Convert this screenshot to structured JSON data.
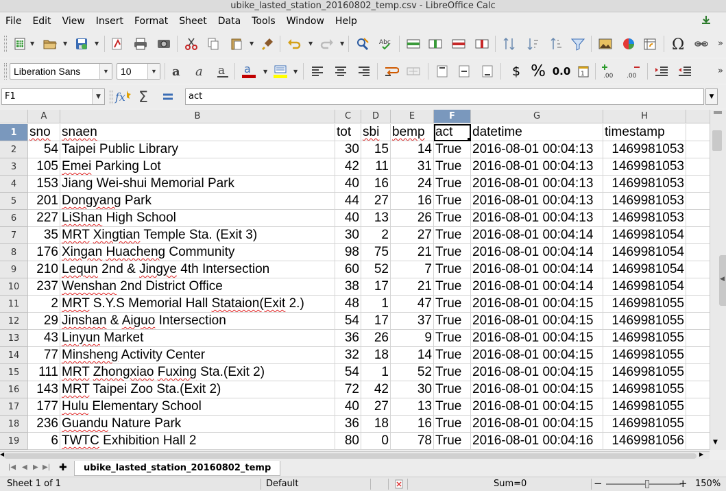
{
  "window": {
    "title": "ubike_lasted_station_20160802_temp.csv - LibreOffice Calc"
  },
  "menu": [
    "File",
    "Edit",
    "View",
    "Insert",
    "Format",
    "Sheet",
    "Data",
    "Tools",
    "Window",
    "Help"
  ],
  "toolbar2": {
    "font_name": "Liberation Sans",
    "font_size": "10",
    "currency": "$",
    "percent": "%",
    "number": "0.0"
  },
  "formula": {
    "name_box": "F1",
    "content": "act"
  },
  "grid": {
    "columns": [
      "A",
      "B",
      "C",
      "D",
      "E",
      "F",
      "G",
      "H"
    ],
    "selected_column": "F",
    "rows": [
      [
        "1",
        "sno",
        "snaen",
        "tot",
        "sbi",
        "bemp",
        "act",
        "datetime",
        "timestamp"
      ],
      [
        "2",
        "54",
        "Taipei Public Library",
        "30",
        "15",
        "14",
        "True",
        "2016-08-01 00:04:13",
        "1469981053"
      ],
      [
        "3",
        "105",
        "Emei Parking Lot",
        "42",
        "11",
        "31",
        "True",
        "2016-08-01 00:04:13",
        "1469981053"
      ],
      [
        "4",
        "153",
        "Jiang Wei-shui Memorial Park",
        "40",
        "16",
        "24",
        "True",
        "2016-08-01 00:04:13",
        "1469981053"
      ],
      [
        "5",
        "201",
        "Dongyang Park",
        "44",
        "27",
        "16",
        "True",
        "2016-08-01 00:04:13",
        "1469981053"
      ],
      [
        "6",
        "227",
        "LiShan High School",
        "40",
        "13",
        "26",
        "True",
        "2016-08-01 00:04:13",
        "1469981053"
      ],
      [
        "7",
        "35",
        "MRT Xingtian Temple Sta. (Exit 3)",
        "30",
        "2",
        "27",
        "True",
        "2016-08-01 00:04:14",
        "1469981054"
      ],
      [
        "8",
        "176",
        "Xingan Huacheng Community",
        "98",
        "75",
        "21",
        "True",
        "2016-08-01 00:04:14",
        "1469981054"
      ],
      [
        "9",
        "210",
        "Lequn 2nd & Jingye 4th Intersection",
        "60",
        "52",
        "7",
        "True",
        "2016-08-01 00:04:14",
        "1469981054"
      ],
      [
        "10",
        "237",
        "Wenshan 2nd District Office",
        "38",
        "17",
        "21",
        "True",
        "2016-08-01 00:04:14",
        "1469981054"
      ],
      [
        "11",
        "2",
        "MRT S.Y.S Memorial Hall Stataion(Exit 2.)",
        "48",
        "1",
        "47",
        "True",
        "2016-08-01 00:04:15",
        "1469981055"
      ],
      [
        "12",
        "29",
        "Jinshan & Aiguo Intersection",
        "54",
        "17",
        "37",
        "True",
        "2016-08-01 00:04:15",
        "1469981055"
      ],
      [
        "13",
        "43",
        "Linyun Market",
        "36",
        "26",
        "9",
        "True",
        "2016-08-01 00:04:15",
        "1469981055"
      ],
      [
        "14",
        "77",
        "Minsheng Activity Center",
        "32",
        "18",
        "14",
        "True",
        "2016-08-01 00:04:15",
        "1469981055"
      ],
      [
        "15",
        "111",
        "MRT Zhongxiao Fuxing Sta.(Exit 2)",
        "54",
        "1",
        "52",
        "True",
        "2016-08-01 00:04:15",
        "1469981055"
      ],
      [
        "16",
        "143",
        "MRT Taipei Zoo Sta.(Exit 2)",
        "72",
        "42",
        "30",
        "True",
        "2016-08-01 00:04:15",
        "1469981055"
      ],
      [
        "17",
        "177",
        "Hulu Elementary School",
        "40",
        "27",
        "13",
        "True",
        "2016-08-01 00:04:15",
        "1469981055"
      ],
      [
        "18",
        "236",
        "Guandu Nature Park",
        "36",
        "18",
        "16",
        "True",
        "2016-08-01 00:04:15",
        "1469981055"
      ],
      [
        "19",
        "6",
        "TWTC Exhibition Hall 2",
        "80",
        "0",
        "78",
        "True",
        "2016-08-01 00:04:16",
        "1469981056"
      ]
    ]
  },
  "sheet_tab": "ubike_lasted_station_20160802_temp",
  "status": {
    "sheet": "Sheet 1 of 1",
    "style": "Default",
    "sum": "Sum=0",
    "zoom": "150%"
  }
}
